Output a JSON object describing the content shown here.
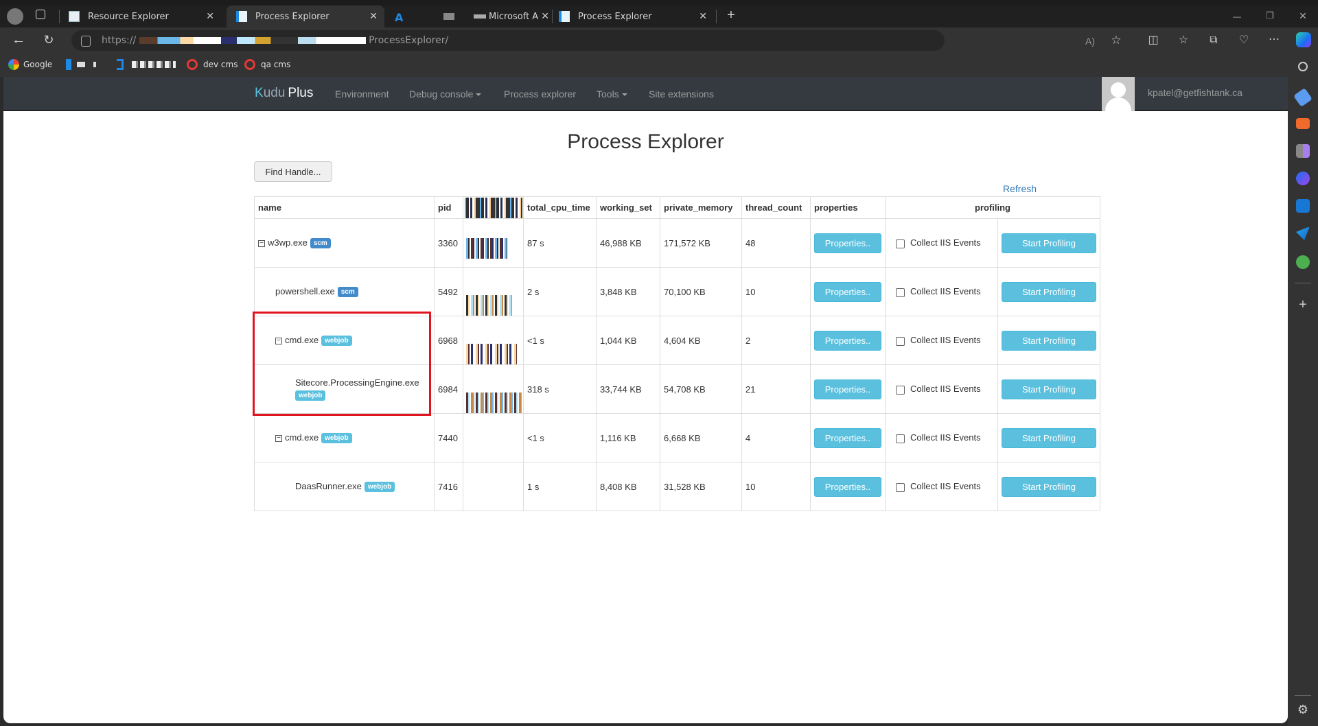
{
  "browser": {
    "tabs": [
      {
        "label": "Resource Explorer",
        "active": false,
        "icon": "resource-explorer-icon"
      },
      {
        "label": "Process Explorer",
        "active": true,
        "icon": "kudu-icon"
      },
      {
        "label": "",
        "active": false,
        "icon": "azure-icon"
      },
      {
        "label": "Microsoft A",
        "active": false,
        "icon": "generic-tab-icon"
      },
      {
        "label": "Process Explorer",
        "active": false,
        "icon": "kudu-icon"
      }
    ],
    "close_glyph": "✕",
    "new_tab_glyph": "+",
    "url_prefix": "https://",
    "url_suffix": "ProcessExplorer/",
    "bookmarks": [
      {
        "label": "Google",
        "icon": "google-icon"
      },
      {
        "label": "",
        "icon": "azure-icon"
      },
      {
        "label": "",
        "icon": "bracket-icon"
      },
      {
        "label": "dev cms",
        "icon": "cms-icon"
      },
      {
        "label": "qa cms",
        "icon": "cms-icon"
      }
    ],
    "window_controls": {
      "minimize": "—",
      "restore": "❐",
      "close": "✕"
    },
    "toolbar_icons": [
      "read-aloud-icon",
      "favorite-star-icon",
      "split-screen-icon",
      "favorites-icon",
      "collections-icon",
      "browser-health-icon",
      "more-icon",
      "copilot-icon"
    ],
    "sidebar_icons": [
      "search-icon",
      "tag-icon",
      "toolbox-icon",
      "chess-icon",
      "copilot-app-icon",
      "outlook-icon",
      "send-icon",
      "tree-icon",
      "add-icon",
      "settings-icon"
    ]
  },
  "navbar": {
    "brand_k": "K",
    "brand_rest": "udu",
    "brand_plus": "Plus",
    "links": [
      {
        "label": "Environment",
        "dropdown": false
      },
      {
        "label": "Debug console",
        "dropdown": true
      },
      {
        "label": "Process explorer",
        "dropdown": false
      },
      {
        "label": "Tools",
        "dropdown": true
      },
      {
        "label": "Site extensions",
        "dropdown": false
      }
    ],
    "user_email": "kpatel@getfishtank.ca"
  },
  "page": {
    "title": "Process Explorer",
    "find_handle_label": "Find Handle...",
    "refresh_label": "Refresh"
  },
  "table": {
    "headers": {
      "name": "name",
      "pid": "pid",
      "total_cpu_time": "total_cpu_time",
      "working_set": "working_set",
      "private_memory": "private_memory",
      "thread_count": "thread_count",
      "properties": "properties",
      "profiling": "profiling"
    },
    "rows": [
      {
        "name": "w3wp.exe",
        "badge": "scm",
        "toggle": "⊟",
        "level": 0,
        "pid": "3360",
        "total_cpu_time": "87 s",
        "working_set": "46,988 KB",
        "private_memory": "171,572 KB",
        "thread_count": "48",
        "properties_label": "Properties..",
        "iis_label": "Collect IIS Events",
        "iis_checked": false,
        "profiling_label": "Start Profiling"
      },
      {
        "name": "powershell.exe",
        "badge": "scm",
        "toggle": "",
        "level": 1,
        "pid": "5492",
        "total_cpu_time": "2 s",
        "working_set": "3,848 KB",
        "private_memory": "70,100 KB",
        "thread_count": "10",
        "properties_label": "Properties..",
        "iis_label": "Collect IIS Events",
        "iis_checked": false,
        "profiling_label": "Start Profiling"
      },
      {
        "name": "cmd.exe",
        "badge": "webjob",
        "toggle": "⊟",
        "level": 1,
        "pid": "6968",
        "total_cpu_time": "<1 s",
        "working_set": "1,044 KB",
        "private_memory": "4,604 KB",
        "thread_count": "2",
        "properties_label": "Properties..",
        "iis_label": "Collect IIS Events",
        "iis_checked": false,
        "profiling_label": "Start Profiling"
      },
      {
        "name": "Sitecore.ProcessingEngine.exe",
        "badge": "webjob",
        "toggle": "",
        "level": 2,
        "pid": "6984",
        "total_cpu_time": "318 s",
        "working_set": "33,744 KB",
        "private_memory": "54,708 KB",
        "thread_count": "21",
        "properties_label": "Properties..",
        "iis_label": "Collect IIS Events",
        "iis_checked": false,
        "profiling_label": "Start Profiling"
      },
      {
        "name": "cmd.exe",
        "badge": "webjob",
        "toggle": "⊟",
        "level": 1,
        "pid": "7440",
        "total_cpu_time": "<1 s",
        "working_set": "1,116 KB",
        "private_memory": "6,668 KB",
        "thread_count": "4",
        "properties_label": "Properties..",
        "iis_label": "Collect IIS Events",
        "iis_checked": false,
        "profiling_label": "Start Profiling"
      },
      {
        "name": "DaasRunner.exe",
        "badge": "webjob",
        "toggle": "",
        "level": 2,
        "pid": "7416",
        "total_cpu_time": "1 s",
        "working_set": "8,408 KB",
        "private_memory": "31,528 KB",
        "thread_count": "10",
        "properties_label": "Properties..",
        "iis_label": "Collect IIS Events",
        "iis_checked": false,
        "profiling_label": "Start Profiling"
      }
    ]
  },
  "colors": {
    "navbar_bg": "#343a40",
    "btn_info": "#5bc0de",
    "badge_scm": "#428bca",
    "badge_webjob": "#5bc0de",
    "link": "#337ab7",
    "highlight_border": "#e0141e"
  }
}
